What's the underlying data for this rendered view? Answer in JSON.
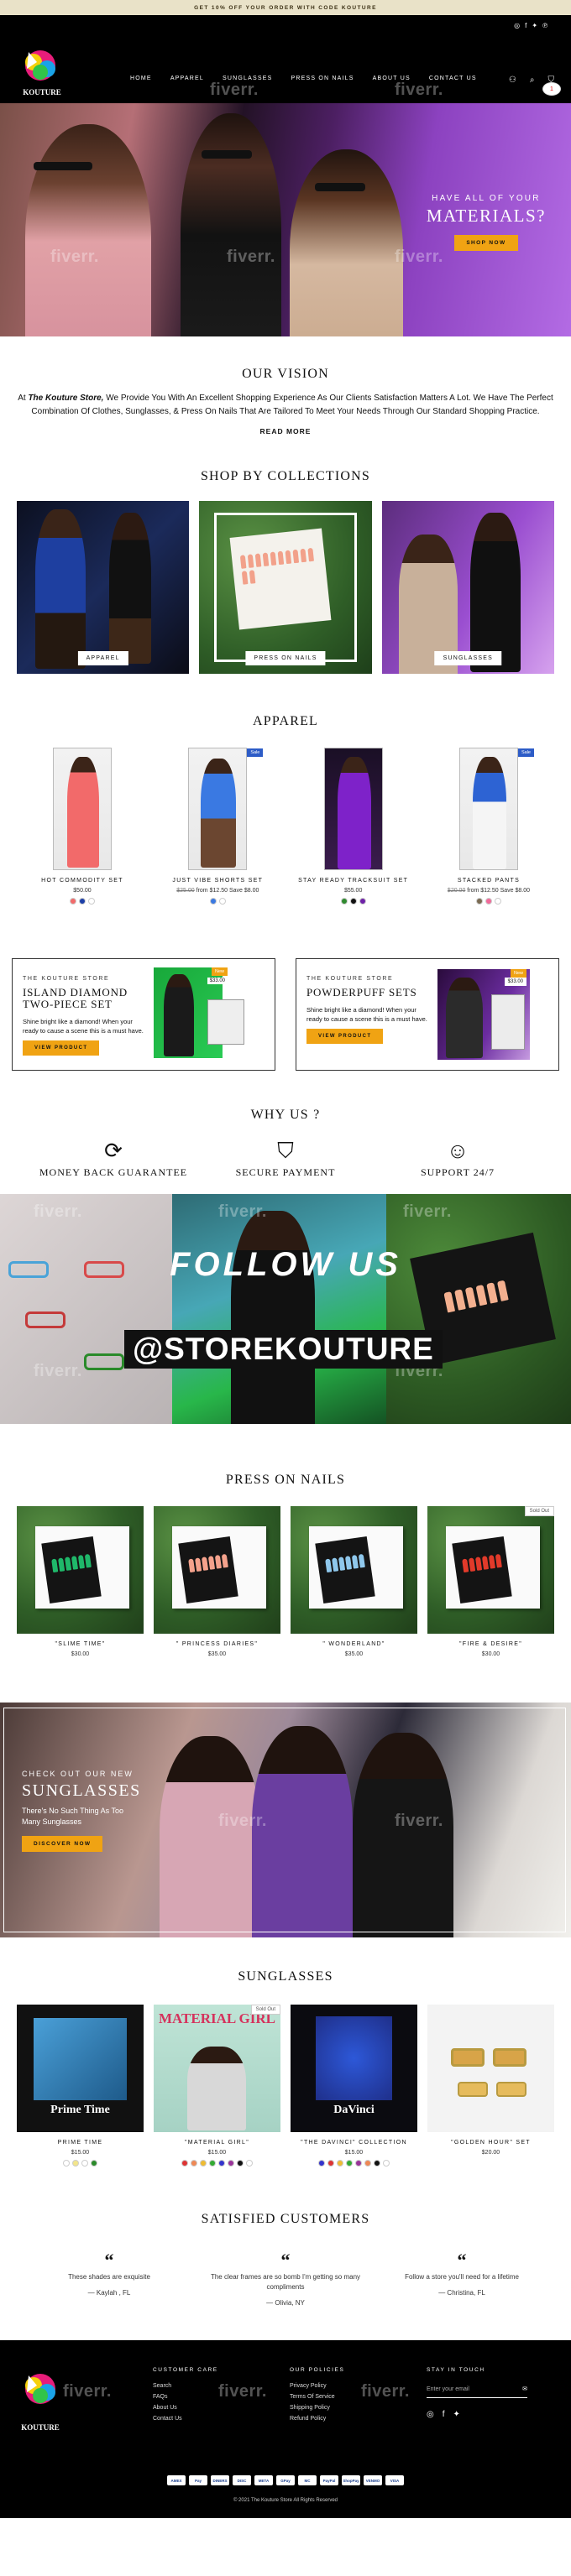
{
  "announcement": "GET 10% OFF YOUR ORDER WITH CODE KOUTURE",
  "header": {
    "logo_text": "KOUTURE",
    "nav": [
      "HOME",
      "APPAREL",
      "SUNGLASSES",
      "PRESS ON NAILS",
      "ABOUT US",
      "CONTACT US"
    ],
    "cart_count": "1",
    "social_icons": [
      "instagram-icon",
      "facebook-icon",
      "twitter-icon",
      "pinterest-icon"
    ]
  },
  "watermark": "fiverr.",
  "hero": {
    "subtitle": "HAVE ALL OF YOUR",
    "title": "MATERIALS?",
    "button": "SHOP NOW"
  },
  "vision": {
    "title": "OUR VISION",
    "lead": "At",
    "brand": "The Kouture Store,",
    "text": "We Provide You With An Excellent Shopping Experience As Our Clients Satisfaction Matters A Lot. We Have The Perfect Combination Of Clothes, Sunglasses, & Press On Nails That Are Tailored To Meet Your Needs Through Our Standard Shopping Practice.",
    "read_more": "READ MORE"
  },
  "collections": {
    "title": "SHOP BY COLLECTIONS",
    "items": [
      "APPAREL",
      "PRESS ON NAILS",
      "SUNGLASSES"
    ]
  },
  "apparel": {
    "title": "APPAREL",
    "products": [
      {
        "name": "HOT COMMODITY SET",
        "price": "$50.00",
        "old": "",
        "save": "",
        "badge": ""
      },
      {
        "name": "JUST VIBE SHORTS SET",
        "price": "$12.50",
        "old": "$25.00",
        "save": "Save $8.00",
        "badge": "Sale"
      },
      {
        "name": "STAY READY TRACKSUIT SET",
        "price": "$55.00",
        "old": "",
        "save": "",
        "badge": ""
      },
      {
        "name": "STACKED PANTS",
        "price": "$12.50",
        "old": "$20.00",
        "save": "Save $8.00",
        "badge": "Sale"
      }
    ],
    "from_label": "from"
  },
  "promos": [
    {
      "kicker": "THE KOUTURE STORE",
      "title1": "ISLAND DIAMOND",
      "title2": "TWO-PIECE SET",
      "desc": "Shine bright like a diamond! When your ready to cause a scene this is a must have.",
      "button": "VIEW PRODUCT",
      "price": "",
      "badge": "New"
    },
    {
      "kicker": "THE KOUTURE STORE",
      "title1": "POWDERPUFF SETS",
      "title2": "",
      "desc": "Shine bright like a diamond! When your ready to cause a scene this is a must have.",
      "button": "VIEW PRODUCT",
      "price": "$33.00",
      "badge": "New"
    }
  ],
  "promo_price_left": "$33.00",
  "why": {
    "title": "WHY US ?",
    "items": [
      "MONEY BACK GUARANTEE",
      "SECURE PAYMENT",
      "SUPPORT 24/7"
    ]
  },
  "follow": {
    "title": "FOLLOW US",
    "handle": "@STOREKOUTURE"
  },
  "nails": {
    "title": "PRESS ON NAILS",
    "products": [
      {
        "name": "\"SLIME TIME\"",
        "price": "$30.00",
        "sold_out": false
      },
      {
        "name": "\" PRINCESS DIARIES\"",
        "price": "$35.00",
        "sold_out": false
      },
      {
        "name": "\" WONDERLAND\"",
        "price": "$35.00",
        "sold_out": false
      },
      {
        "name": "\"FIRE & DESIRE\"",
        "price": "$30.00",
        "sold_out": true
      }
    ],
    "sold_out_label": "Sold Out"
  },
  "sun_banner": {
    "kicker": "CHECK OUT OUR NEW",
    "title": "SUNGLASSES",
    "desc": "There's No Such Thing As Too Many Sunglasses",
    "button": "DISCOVER NOW"
  },
  "sunglasses": {
    "title": "SUNGLASSES",
    "products": [
      {
        "name": "PRIME TIME",
        "price": "$15.00",
        "image_text": "Prime Time",
        "sold_out": false
      },
      {
        "name": "\"MATERIAL GIRL\"",
        "price": "$15.00",
        "image_text": "MATERIAL GIRL",
        "sold_out": true
      },
      {
        "name": "\"THE DAVINCI\" COLLECTION",
        "price": "$15.00",
        "image_text": "DaVinci",
        "sold_out": false
      },
      {
        "name": "\"GOLDEN HOUR\" SET",
        "price": "$20.00",
        "image_text": "",
        "sold_out": false
      }
    ]
  },
  "testimonials": {
    "title": "SATISFIED CUSTOMERS",
    "items": [
      {
        "text": "These shades are exquisite",
        "author": "— Kaylah , FL"
      },
      {
        "text": "The clear frames are so bomb I'm getting so many compliments",
        "author": "— Olivia, NY"
      },
      {
        "text": "Follow a store you'll need for a lifetime",
        "author": "— Christina, FL"
      }
    ]
  },
  "footer": {
    "care_title": "CUSTOMER CARE",
    "care_links": [
      "Search",
      "FAQs",
      "About Us",
      "Contact Us"
    ],
    "policy_title": "OUR POLICIES",
    "policy_links": [
      "Privacy Policy",
      "Terms Of Service",
      "Shipping Policy",
      "Refund Policy"
    ],
    "touch_title": "STAY IN TOUCH",
    "email_placeholder": "Enter your email",
    "payments": [
      "AMEX",
      "Pay",
      "DINERS",
      "DISC",
      "META",
      "GPay",
      "MC",
      "PayPal",
      "ShopPay",
      "VENMO",
      "VISA"
    ],
    "copyright": "© 2021 The Kouture Store All Rights Reserved"
  },
  "colors": {
    "accent": "#f0a313",
    "header_bg": "#000000",
    "sale_badge": "#2d5cc7",
    "announce_bg": "#e9e2c8"
  }
}
